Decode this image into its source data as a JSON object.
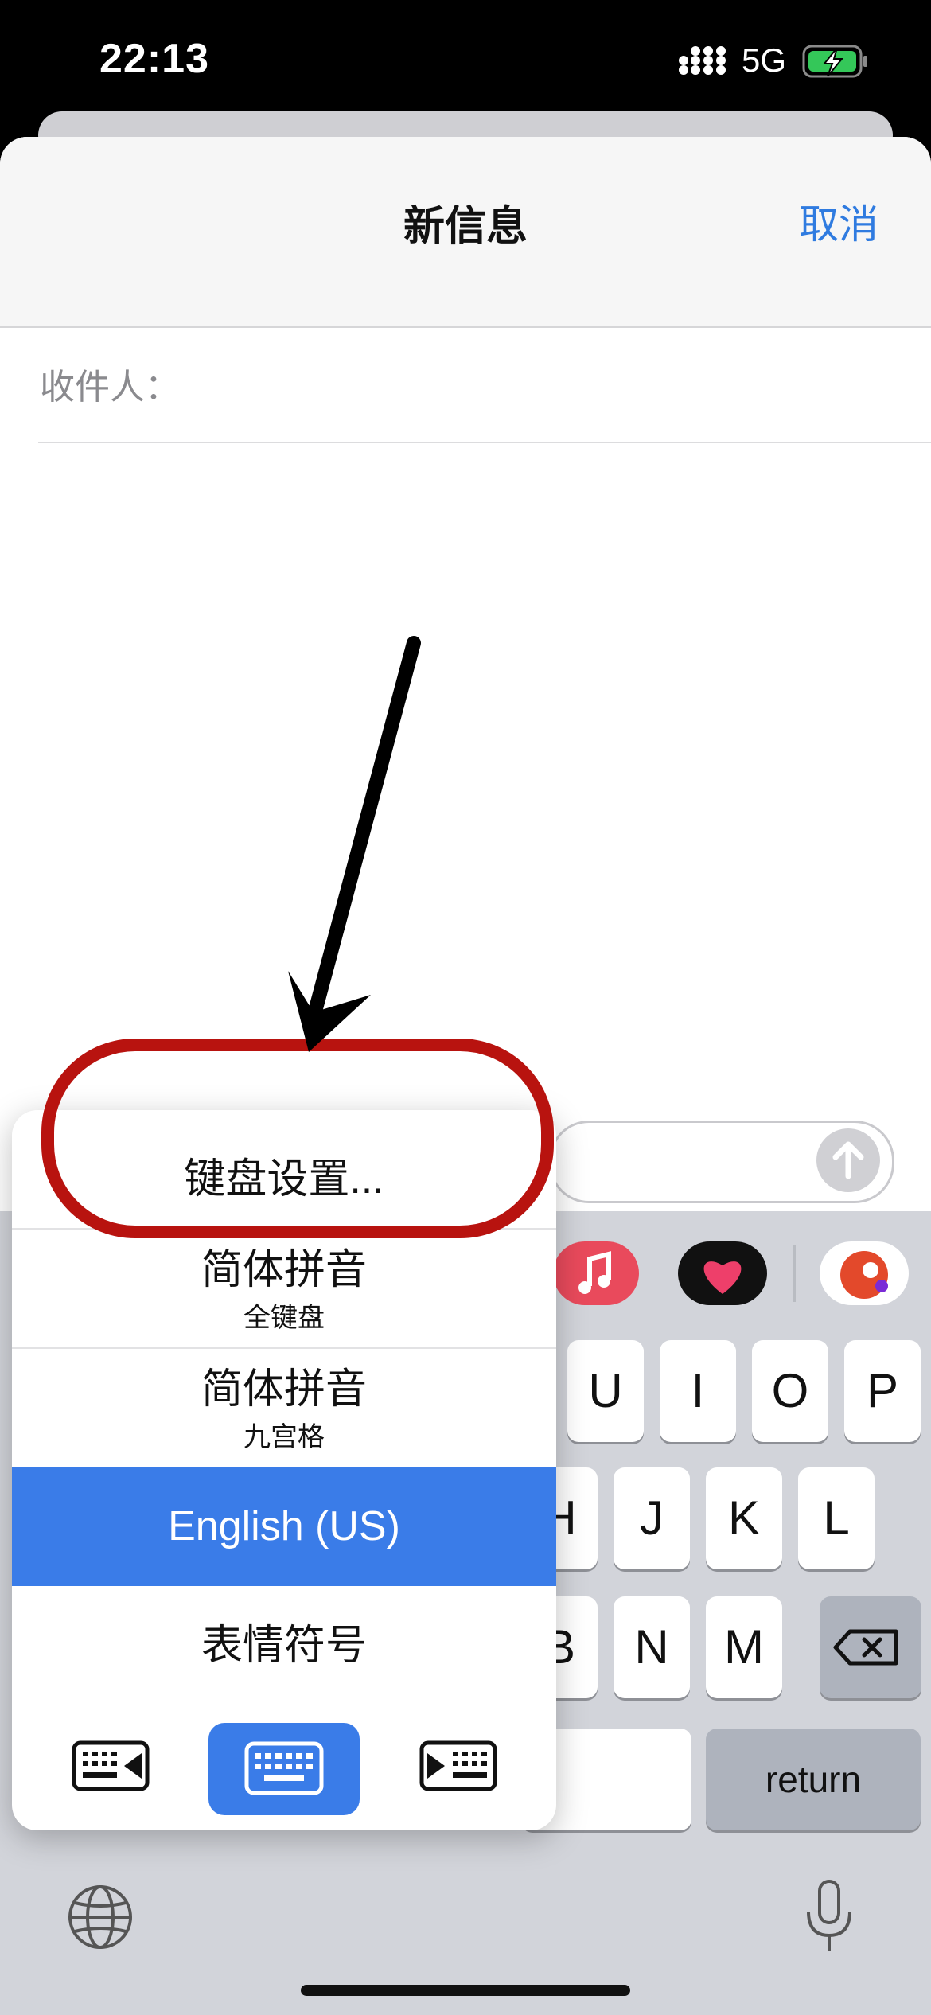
{
  "status_bar": {
    "time": "22:13",
    "network": "5G"
  },
  "nav": {
    "title": "新信息",
    "cancel": "取消"
  },
  "compose": {
    "to_label": "收件人："
  },
  "keyboard_menu": {
    "settings": "键盘设置...",
    "items": [
      {
        "label": "简体拼音",
        "sub": "全键盘"
      },
      {
        "label": "简体拼音",
        "sub": "九宫格"
      },
      {
        "label": "English (US)",
        "sub": ""
      },
      {
        "label": "表情符号",
        "sub": ""
      }
    ],
    "selected_index": 2
  },
  "keyboard": {
    "row1": [
      "U",
      "I",
      "O",
      "P"
    ],
    "row2": [
      "H",
      "J",
      "K",
      "L"
    ],
    "row3": [
      "B",
      "N",
      "M"
    ],
    "return": "return"
  },
  "icons": [
    "signal-icon",
    "battery-charging-icon",
    "send-arrow-icon",
    "music-app-icon",
    "heart-app-icon",
    "bird-app-icon",
    "delete-icon",
    "globe-icon",
    "microphone-icon",
    "keyboard-left-icon",
    "keyboard-full-icon",
    "keyboard-right-icon"
  ],
  "colors": {
    "accent": "#2f7be0",
    "selected": "#3a7ce8",
    "annotation": "#b8130f"
  }
}
